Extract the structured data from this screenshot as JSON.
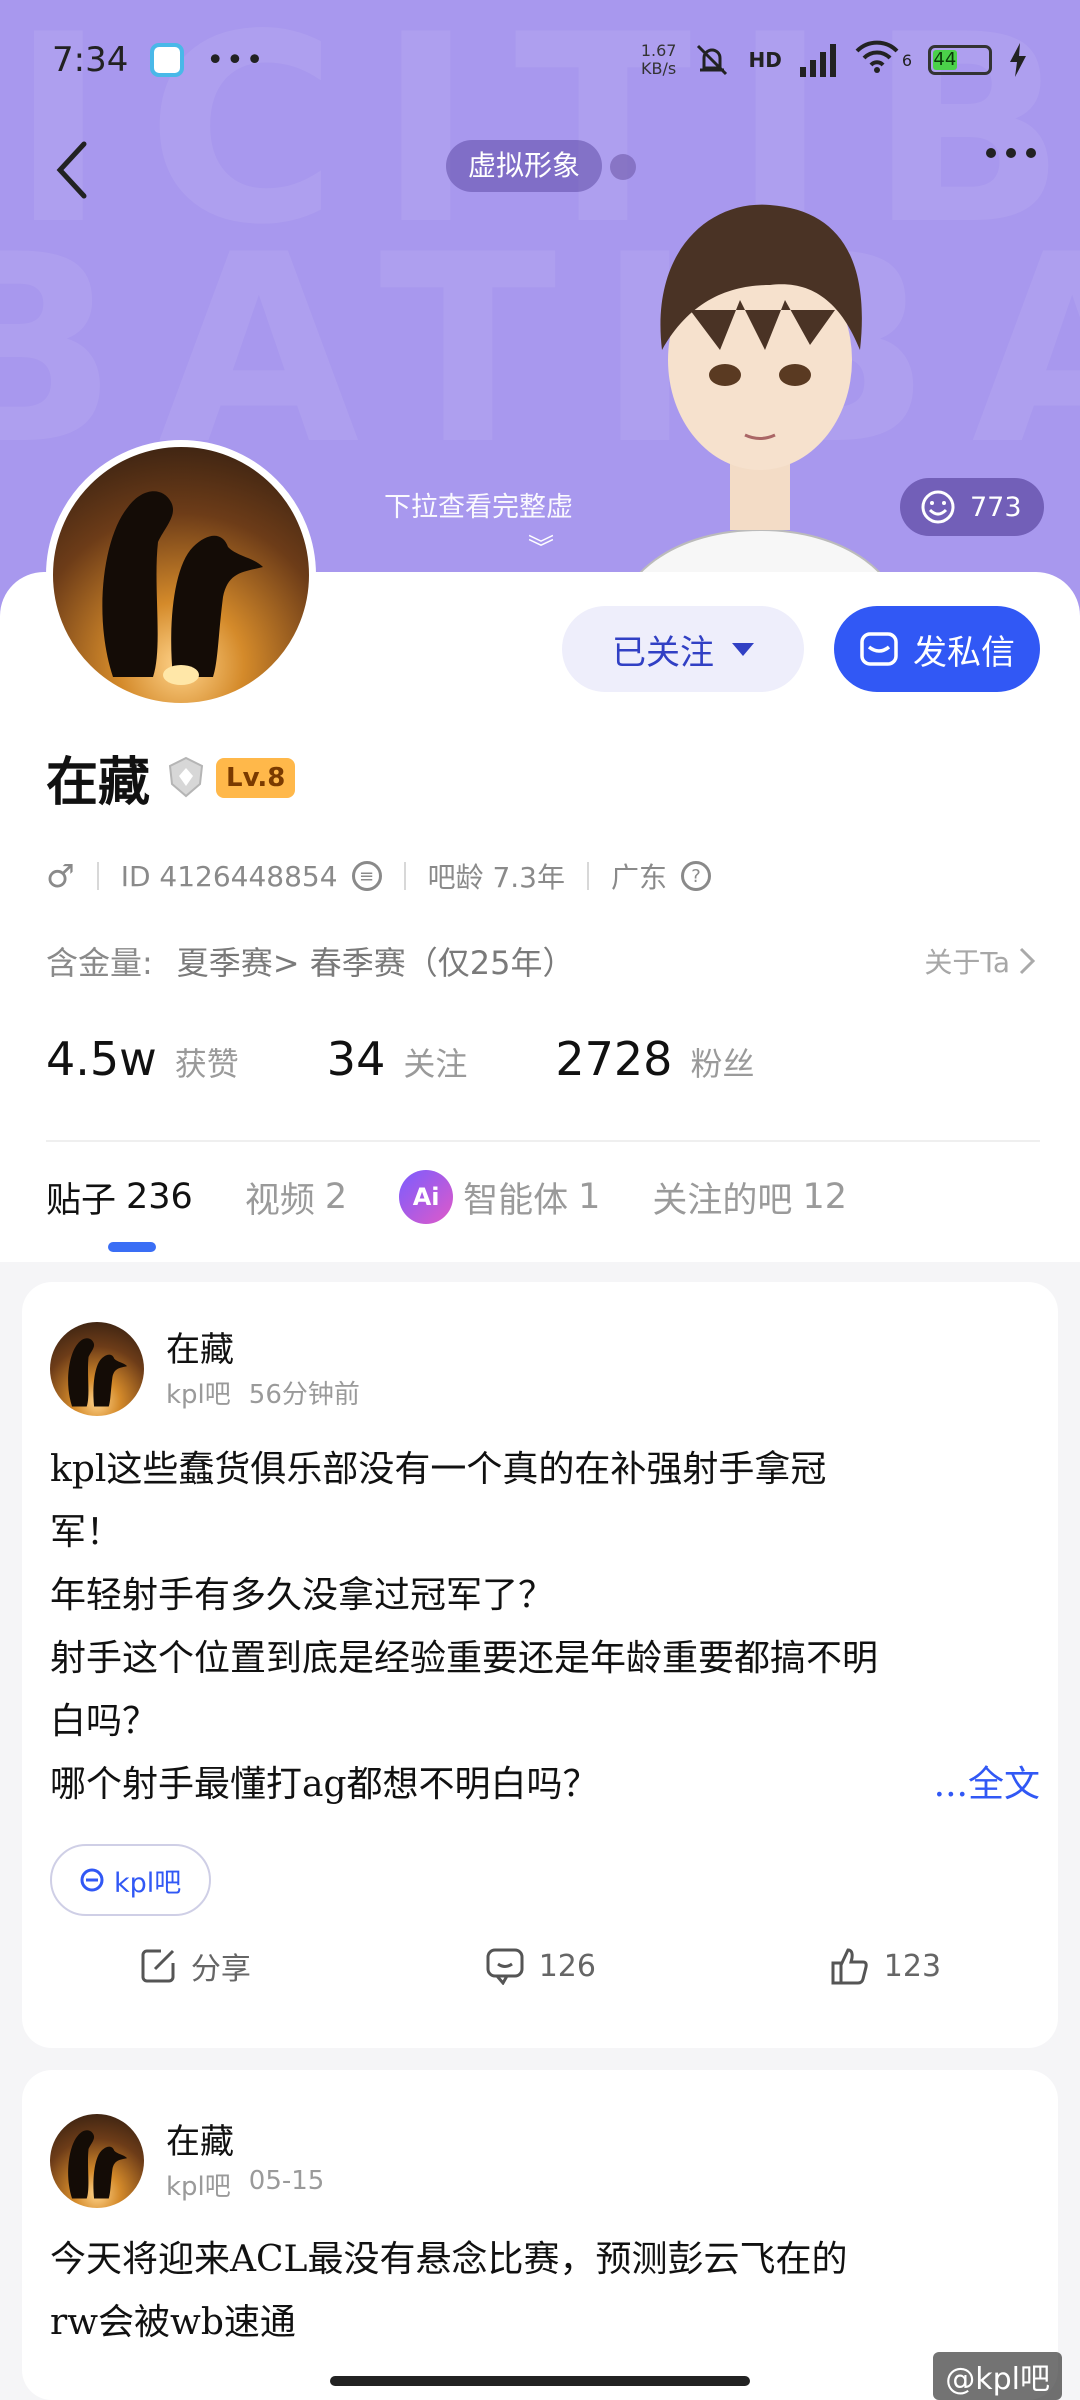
{
  "status_bar": {
    "time": "7:34",
    "net_speed_value": "1.67",
    "net_speed_unit": "KB/s",
    "network": "HD",
    "wifi_label": "6",
    "battery": "44",
    "icons": [
      "app-icon",
      "more-dots-icon",
      "mute-icon",
      "signal-icon",
      "wifi-icon",
      "battery-icon",
      "charging-icon"
    ]
  },
  "header": {
    "avatar_tag": "虚拟形象",
    "pull_hint": "下拉查看完整虚",
    "like_count": "773",
    "colors": {
      "hero_bg": "#a898ee",
      "accent": "#3158f5"
    }
  },
  "profile": {
    "username": "在藏",
    "level": "Lv.8",
    "gender_symbol": "♂",
    "id_text": "ID 4126448854",
    "bar_age": "吧龄 7.3年",
    "region": "广东",
    "gold_label": "含金量:",
    "gold_value": "夏季赛> 春季赛（仅25年）",
    "about": "关于Ta",
    "follow_label": "已关注",
    "dm_label": "发私信"
  },
  "stats": [
    {
      "num": "4.5w",
      "label": "获赞"
    },
    {
      "num": "34",
      "label": "关注"
    },
    {
      "num": "2728",
      "label": "粉丝"
    }
  ],
  "tabs": [
    {
      "label": "贴子",
      "count": "236"
    },
    {
      "label": "视频",
      "count": "2"
    },
    {
      "label": "智能体",
      "count": "1"
    },
    {
      "label": "关注的吧",
      "count": "12"
    }
  ],
  "posts": [
    {
      "author": "在藏",
      "bar": "kpl吧",
      "time": "56分钟前",
      "lines": [
        "kpl这些蠢货俱乐部没有一个真的在补强射手拿冠",
        "军！",
        "年轻射手有多久没拿过冠军了？",
        "射手这个位置到底是经验重要还是年龄重要都搞不明",
        "白吗？",
        "哪个射手最懂打ag都想不明白吗？"
      ],
      "more": "...全文",
      "tag": "kpl吧",
      "share": "分享",
      "comments": "126",
      "likes": "123"
    },
    {
      "author": "在藏",
      "bar": "kpl吧",
      "time": "05-15",
      "lines": [
        "今天将迎来ACL最没有悬念比赛，预测彭云飞在的",
        "rw会被wb速通"
      ]
    }
  ],
  "watermark": "@kpl吧",
  "ai_icon_label": "Ai"
}
